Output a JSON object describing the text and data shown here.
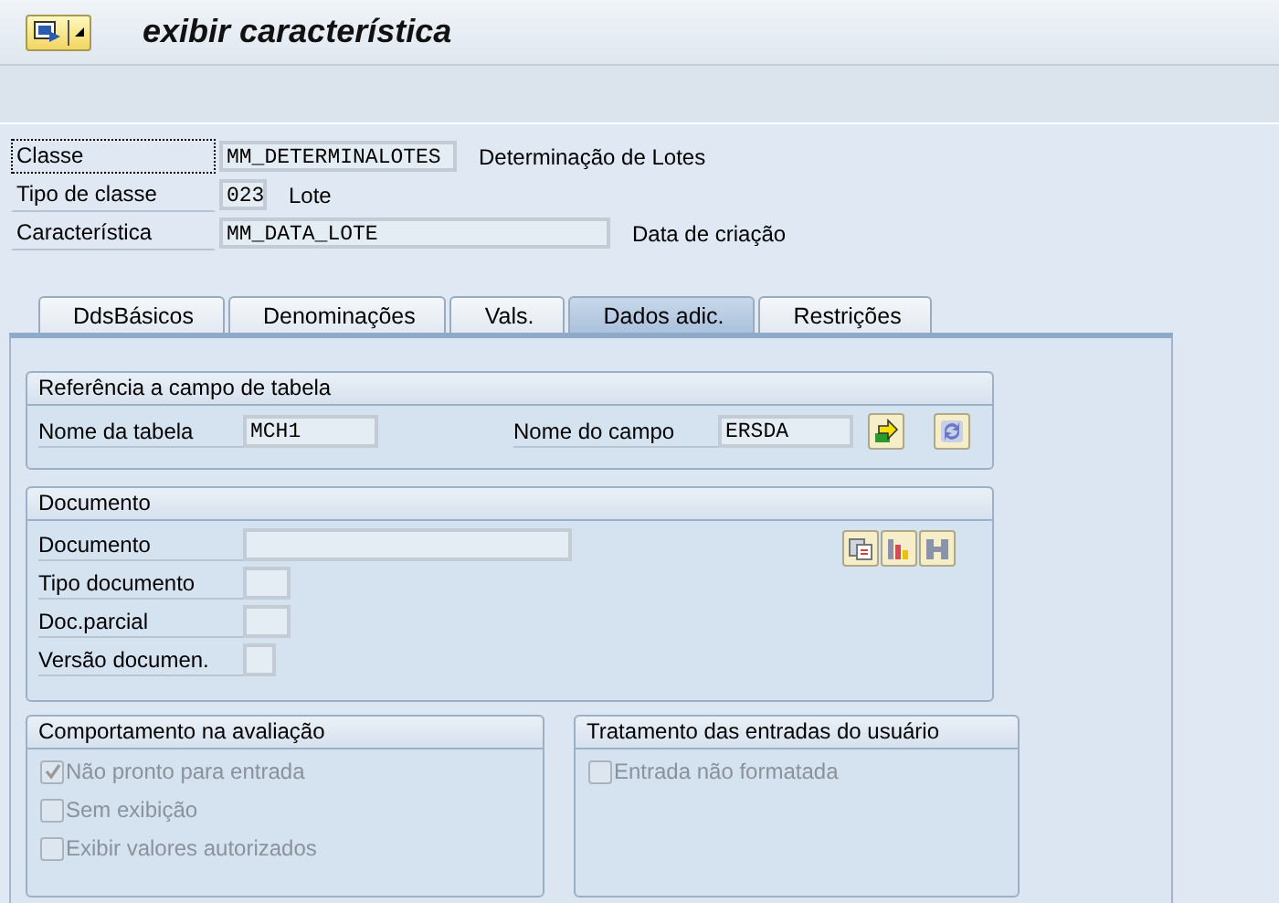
{
  "window": {
    "title": "exibir característica"
  },
  "header": [
    {
      "label": "Classe",
      "value": "MM_DETERMINALOTES",
      "description": "Determinação de Lotes",
      "focused": true
    },
    {
      "label": "Tipo de classe",
      "value": "023",
      "description": "Lote",
      "focused": false
    },
    {
      "label": "Característica",
      "value": "MM_DATA_LOTE",
      "description": "Data de criação",
      "focused": false
    }
  ],
  "tabs": [
    {
      "label": "DdsBásicos",
      "selected": false
    },
    {
      "label": "Denominações",
      "selected": false
    },
    {
      "label": "Vals.",
      "selected": false
    },
    {
      "label": "Dados adic.",
      "selected": true
    },
    {
      "label": "Restrições",
      "selected": false
    }
  ],
  "table_reference": {
    "title": "Referência a campo de tabela",
    "table_label": "Nome da tabela",
    "table_value": "MCH1",
    "field_label": "Nome do campo",
    "field_value": "ERSDA"
  },
  "document": {
    "title": "Documento",
    "fields": [
      {
        "label": "Documento"
      },
      {
        "label": "Tipo documento"
      },
      {
        "label": "Doc.parcial"
      },
      {
        "label": "Versão documen."
      }
    ]
  },
  "evaluation": {
    "title": "Comportamento na avaliação",
    "options": [
      {
        "label": "Não pronto para entrada",
        "checked": true,
        "disabled": true
      },
      {
        "label": "Sem exibição",
        "checked": false,
        "disabled": true
      },
      {
        "label": "Exibir valores autorizados",
        "checked": false,
        "disabled": true
      }
    ]
  },
  "user_input": {
    "title": "Tratamento das entradas do usuário",
    "options": [
      {
        "label": "Entrada não formatada",
        "checked": false,
        "disabled": true
      }
    ]
  }
}
